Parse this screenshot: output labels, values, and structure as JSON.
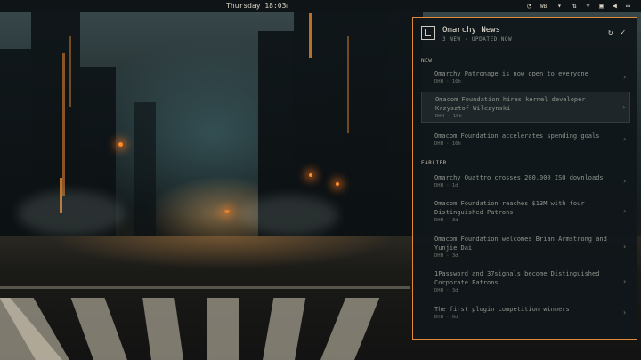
{
  "topbar": {
    "clock": "Thursday 18:03",
    "icons": [
      "download-icon",
      "rss-icon",
      "wb-indicator",
      "mic-icon",
      "network-icon",
      "bluetooth-icon",
      "battery-icon",
      "volume-icon",
      "display-icon"
    ],
    "wb_label": "WB"
  },
  "panel": {
    "title": "Omarchy News",
    "subtitle": "3 NEW · UPDATED NOW",
    "refresh_icon": "↻",
    "check_icon": "✓",
    "section_new": "NEW",
    "section_earlier": "EARLIER",
    "new_items": [
      {
        "title": "Omarchy Patronage is now open to everyone",
        "meta": "DHH · 16h"
      },
      {
        "title": "Omacom Foundation hires kernel developer Krzysztof Wilczynski",
        "meta": "DHH · 16h"
      },
      {
        "title": "Omacom Foundation accelerates spending goals",
        "meta": "DHH · 16h"
      }
    ],
    "earlier_items": [
      {
        "title": "Omarchy Quattro crosses 200,000 ISO downloads",
        "meta": "DHH · 1d"
      },
      {
        "title": "Omacom Foundation reaches $13M with four Distinguished Patrons",
        "meta": "DHH · 3d"
      },
      {
        "title": "Omacom Foundation welcomes Brian Armstrong and Yunjie Dai",
        "meta": "DHH · 3d"
      },
      {
        "title": "1Password and 37signals become Distinguished Corporate Patrons",
        "meta": "DHH · 3d"
      },
      {
        "title": "The first plugin competition winners",
        "meta": "DHH · 6d"
      }
    ],
    "chevron": "›",
    "accent_color": "#e08a3a"
  }
}
